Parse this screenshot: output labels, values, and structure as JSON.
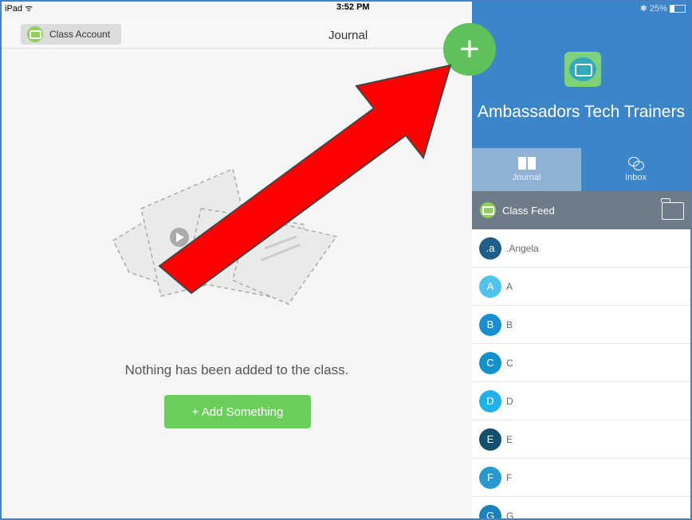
{
  "status": {
    "device": "iPad",
    "time": "3:52 PM",
    "battery": "25%",
    "battery_level": 0.25
  },
  "nav": {
    "class_button_label": "Class Account",
    "title": "Journal"
  },
  "empty": {
    "message": "Nothing has been added to the class.",
    "add_label": "+ Add Something"
  },
  "panel": {
    "class_name": "Ambassadors Tech Trainers",
    "tabs": [
      {
        "label": "Journal",
        "icon": "book-icon"
      },
      {
        "label": "Inbox",
        "icon": "chat-bubbles-icon"
      }
    ],
    "feed_label": "Class Feed",
    "plus_label": "+",
    "students": [
      {
        "initial": ".a",
        "name": ".Angela",
        "color": "#1d5f86"
      },
      {
        "initial": "A",
        "name": "A",
        "color": "#4fc2ee"
      },
      {
        "initial": "B",
        "name": "B",
        "color": "#1a8ed0"
      },
      {
        "initial": "C",
        "name": "C",
        "color": "#1591c9"
      },
      {
        "initial": "D",
        "name": "D",
        "color": "#22b0e8"
      },
      {
        "initial": "E",
        "name": "E",
        "color": "#14506e"
      },
      {
        "initial": "F",
        "name": "F",
        "color": "#2a98d0"
      },
      {
        "initial": "G",
        "name": "G",
        "color": "#1a82bd"
      }
    ]
  },
  "colors": {
    "accent_blue": "#3b86c8",
    "green": "#6bcd5a",
    "arrow_red": "#ff0000"
  }
}
